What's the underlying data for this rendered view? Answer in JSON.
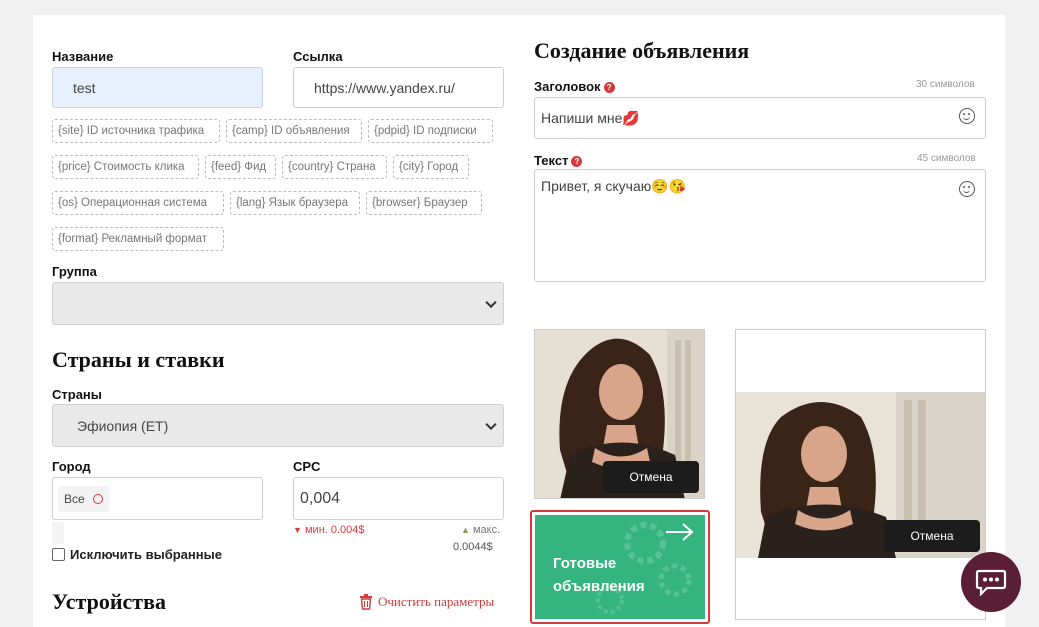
{
  "left": {
    "name_label": "Название",
    "name_value": "test",
    "link_label": "Ссылка",
    "link_value": "https://www.yandex.ru/",
    "macros": [
      "{site} ID источника трафика",
      "{camp} ID объявления",
      "{pdpid} ID подписки",
      "{price} Стоимость клика",
      "{feed} Фид",
      "{country} Страна",
      "{city} Город",
      "{os} Операционная система",
      "{lang} Язык браузера",
      "{browser} Браузер",
      "{format} Рекламный формат"
    ],
    "group_label": "Группа",
    "group_value": "",
    "countries_heading": "Страны и ставки",
    "countries_label": "Страны",
    "country_value": "Эфиопия (ET)",
    "city_label": "Город",
    "city_chip": "Все",
    "cpc_label": "CPC",
    "cpc_value": "0,004",
    "cpc_min": "мин. 0.004$",
    "cpc_max_label": "макс.",
    "cpc_max": "0.0044$",
    "exclude_label": "Исключить выбранные",
    "devices_heading": "Устройства",
    "clear_params": "Очистить параметры"
  },
  "right": {
    "heading": "Создание объявления",
    "title_label": "Заголовок",
    "title_counter": "30 символов",
    "title_value": "Напиши мне💋",
    "text_label": "Текст",
    "text_counter": "45 символов",
    "text_value": "Привет, я скучаю☺️😘",
    "cancel_label": "Отмена",
    "cancel_label_2": "Отмена",
    "ready_ads_line1": "Готовые",
    "ready_ads_line2": "объявления",
    "accent_green": "#34b57f",
    "accent_red": "#d43a3a"
  },
  "chat": {
    "icon": "chat-bubble-icon",
    "color": "#5a1e35"
  }
}
